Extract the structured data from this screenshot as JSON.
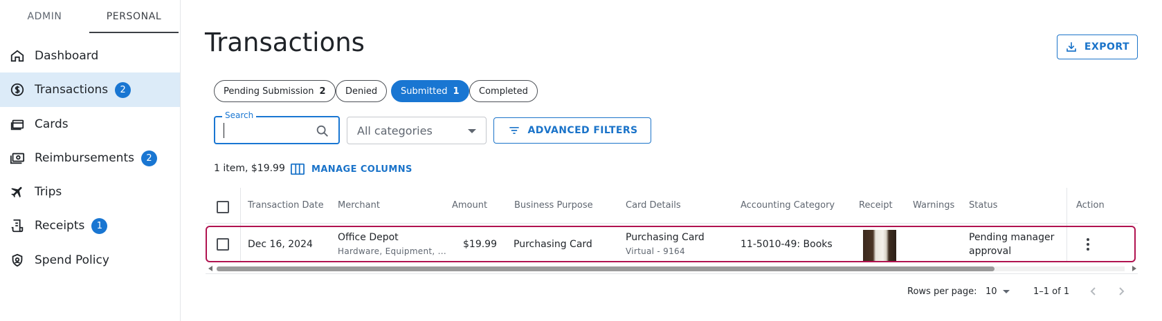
{
  "sidebar": {
    "role_tabs": [
      "ADMIN",
      "PERSONAL"
    ],
    "items": [
      {
        "label": "Dashboard",
        "icon": "home-icon",
        "badge": null
      },
      {
        "label": "Transactions",
        "icon": "dollar-circle-icon",
        "badge": "2"
      },
      {
        "label": "Cards",
        "icon": "cards-icon",
        "badge": null
      },
      {
        "label": "Reimbursements",
        "icon": "cash-icon",
        "badge": "2"
      },
      {
        "label": "Trips",
        "icon": "airplane-icon",
        "badge": null
      },
      {
        "label": "Receipts",
        "icon": "receipt-icon",
        "badge": "1"
      },
      {
        "label": "Spend Policy",
        "icon": "shield-icon",
        "badge": null
      }
    ],
    "active": "Transactions"
  },
  "main": {
    "title": "Transactions",
    "export_label": "EXPORT",
    "chips": [
      {
        "label": "Pending Submission",
        "count": "2"
      },
      {
        "label": "Denied",
        "count": ""
      },
      {
        "label": "Submitted",
        "count": "1"
      },
      {
        "label": "Completed",
        "count": ""
      }
    ],
    "active_chip": "Submitted",
    "search": {
      "legend": "Search",
      "value": ""
    },
    "category_select": "All categories",
    "advanced_filters_label": "ADVANCED FILTERS",
    "summary": "1 item, $19.99",
    "manage_columns_label": "MANAGE COLUMNS"
  },
  "table": {
    "columns": [
      "Transaction Date",
      "Merchant",
      "Amount",
      "Business Purpose",
      "Card Details",
      "Accounting Category",
      "Receipt",
      "Warnings",
      "Status",
      "Action"
    ],
    "rows": [
      {
        "date": "Dec 16, 2024",
        "merchant": "Office Depot",
        "merchant_sub": "Hardware, Equipment, ...",
        "amount": "$19.99",
        "business_purpose": "Purchasing Card",
        "card": "Purchasing Card",
        "card_sub": "Virtual - 9164",
        "accounting_category": "11-5010-49: Books",
        "warnings": "",
        "status_line1": "Pending manager",
        "status_line2": "approval"
      }
    ]
  },
  "pagination": {
    "rows_per_page_label": "Rows per page:",
    "rows_per_page": "10",
    "range": "1–1 of 1"
  },
  "colors": {
    "accent": "#1976d2",
    "active_nav_bg": "#dcebf8",
    "row_highlight": "#b0124f"
  }
}
